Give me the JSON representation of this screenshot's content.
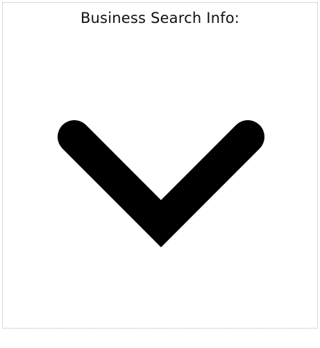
{
  "header": {
    "title": "Business Search Info:"
  },
  "toggle": {
    "icon": "chevron-down-icon",
    "color": "#000000"
  },
  "colors": {
    "background": "#ffffff",
    "border": "#b5b5b5",
    "text": "#111111"
  }
}
